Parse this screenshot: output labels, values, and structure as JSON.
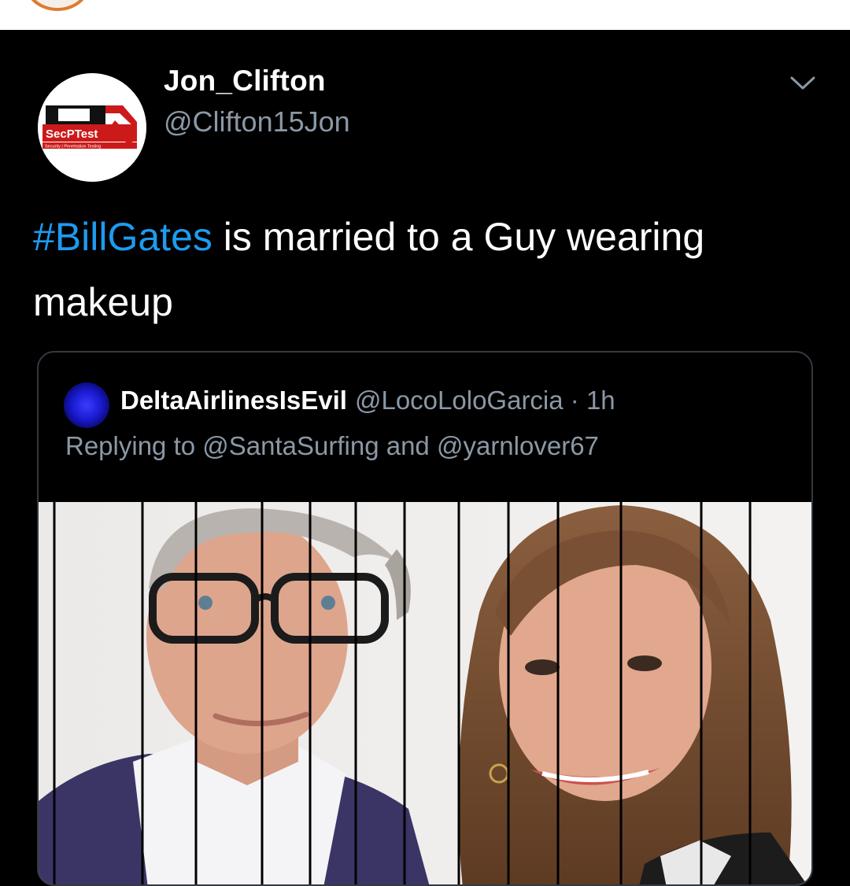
{
  "tweet": {
    "author_name": "Jon_Clifton",
    "author_handle": "@Clifton15Jon",
    "avatar_logo_text": "SecPTest",
    "avatar_logo_subtext": "Security | Penetration Testing",
    "hashtag": "#BillGates",
    "text_rest": " is married to a Guy wearing makeup"
  },
  "quoted": {
    "author_name": "DeltaAirlinesIsEvil",
    "author_handle": "@LocoLoloGarcia",
    "separator": " · ",
    "time": "1h",
    "reply_prefix": "Replying to ",
    "reply_user1": "@SantaSurfing",
    "reply_and": " and ",
    "reply_user2": "@yarnlover67"
  },
  "colors": {
    "background": "#000000",
    "text": "#ffffff",
    "secondary": "#8b98a5",
    "link": "#1d9bf0",
    "border": "#333a41"
  },
  "icons": {
    "menu": "chevron-down-icon"
  }
}
